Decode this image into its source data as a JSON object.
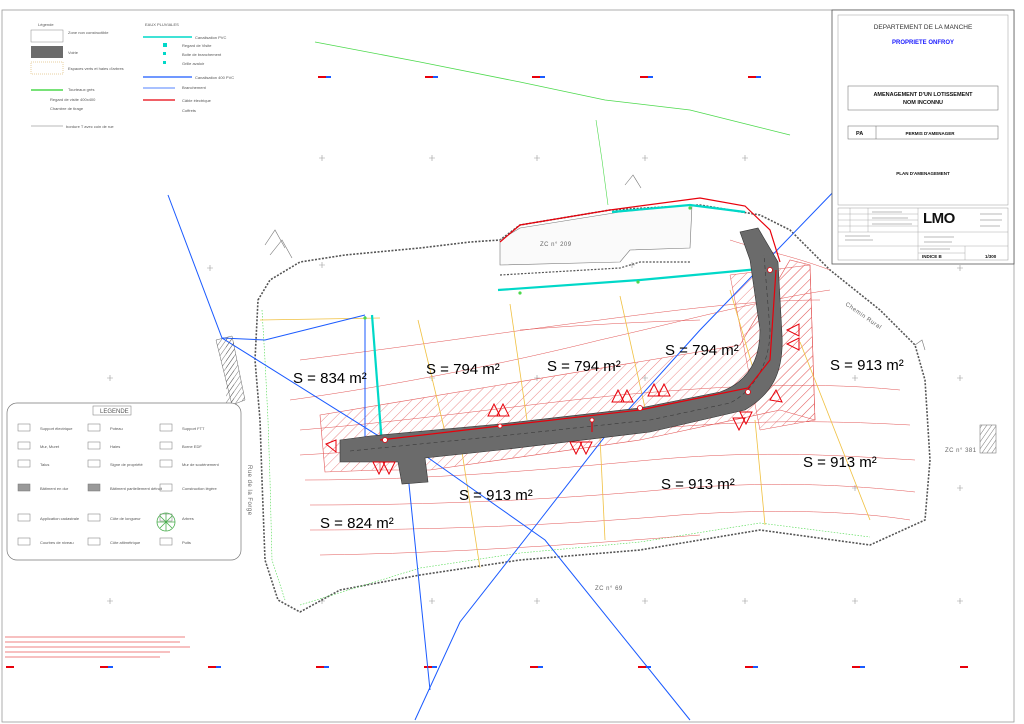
{
  "title_block": {
    "department": "DEPARTEMENT DE LA MANCHE",
    "owner": "PROPRIETE ONFROY",
    "project_line1": "AMENAGEMENT D'UN LOTISSEMENT",
    "project_line2": "NOM INCONNU",
    "pa_code": "PA",
    "permit": "PERMIS D'AMENAGER",
    "plan_name": "PLAN D'AMENAGEMENT",
    "logo": "LMO",
    "index": "INDICE B",
    "scale": "1/300"
  },
  "top_legend": {
    "title": "Légende",
    "items": [
      "Zone non constructible",
      "Voirie",
      "Espaces verts et haies d'arbres",
      "Tourteaux grès",
      "Regard de visite 400x400",
      "Chambre de tirage",
      "bordure T avec coin de rue"
    ],
    "networks_title": "EAUX PLUVIALES",
    "networks": [
      "Canalisation PVC",
      "Regard de Visite",
      "Boite de branchement",
      "Grille avaloir",
      "Canalisation 400 PVC",
      "Branchement",
      "Câble électrique",
      "Coffrets"
    ]
  },
  "lower_legend": {
    "title": "LEGENDE",
    "items": [
      "Support électrique",
      "Poteau",
      "Support FTT",
      "Mur, Muret",
      "Haies",
      "Borne EDF",
      "Talus",
      "Signe de propriété",
      "Mur de soutènement",
      "Bâtiment en dur",
      "Bâtiment partiellement détruit",
      "Construction légère",
      "Application cadastrale",
      "Côte de longueur",
      "Arbres",
      "Courbes de niveau",
      "Côte altimétrique",
      "Puits"
    ]
  },
  "parcels": [
    {
      "label": "S = 834 m²"
    },
    {
      "label": "S = 794 m²"
    },
    {
      "label": "S = 794 m²"
    },
    {
      "label": "S = 794 m²"
    },
    {
      "label": "S = 913 m²"
    },
    {
      "label": "S = 913 m²"
    },
    {
      "label": "S = 913 m²"
    },
    {
      "label": "S = 913 m²"
    },
    {
      "label": "S = 824 m²"
    }
  ],
  "map_labels": {
    "zc_top": "ZC n° 209",
    "zc_bottom": "ZC n° 69",
    "zc_right": "ZC n° 381",
    "road_left": "Rue de la Forge",
    "road_right": "Chemin Rural"
  },
  "colors": {
    "road": "#6b6b6b",
    "boundary": "#e8000b",
    "cyan_network": "#00d8c8",
    "blue_network": "#1a5aff",
    "green_network": "#4cd94c",
    "parcel_lines": "#f0c040"
  }
}
